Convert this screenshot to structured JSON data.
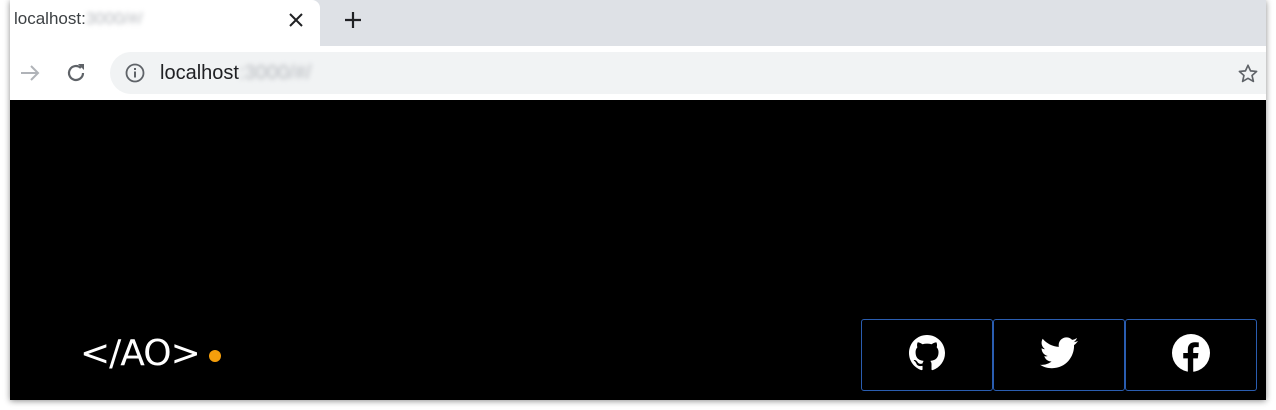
{
  "browser": {
    "tab": {
      "title": "localhost:",
      "title_blurred": "3000/#/",
      "close_icon": "close-icon"
    },
    "new_tab_icon": "plus-icon",
    "toolbar": {
      "forward_icon": "arrow-right-icon",
      "reload_icon": "reload-icon",
      "info_icon": "info-icon",
      "bookmark_icon": "star-icon"
    },
    "address_bar": {
      "url": "localhost",
      "url_blurred": ":3000/#/"
    }
  },
  "page": {
    "logo": {
      "text": "</AO>",
      "dot_color": "#f59e0b"
    },
    "social_links": [
      {
        "name": "github",
        "icon": "github-icon"
      },
      {
        "name": "twitter",
        "icon": "twitter-icon"
      },
      {
        "name": "facebook",
        "icon": "facebook-icon"
      }
    ],
    "accent_border_color": "#2a5db0",
    "background": "#000000"
  }
}
